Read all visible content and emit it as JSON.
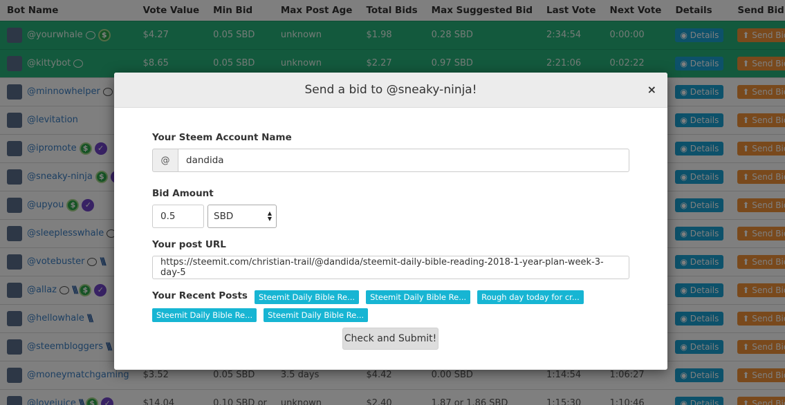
{
  "table": {
    "headers": [
      "Bot Name",
      "Vote Value",
      "Min Bid",
      "Max Post Age",
      "Total Bids",
      "Max Suggested Bid",
      "Last Vote",
      "Next Vote",
      "Details",
      "Send Bid"
    ],
    "details_label": "Details",
    "send_label": "Send Bid",
    "rows": [
      {
        "name": "@yourwhale",
        "vote_value": "$4.27",
        "min_bid": "0.05 SBD",
        "max_age": "unknown",
        "total_bids": "$1.98",
        "max_bid": "0.28 SBD",
        "last_vote": "2:34:54",
        "next_vote": "0:00:00",
        "active": true,
        "icons": [
          "comment-icon",
          "dollar-icon"
        ]
      },
      {
        "name": "@kittybot",
        "vote_value": "$8.65",
        "min_bid": "0.05 SBD",
        "max_age": "unknown",
        "total_bids": "$2.27",
        "max_bid": "0.97 SBD",
        "last_vote": "2:21:06",
        "next_vote": "0:02:22",
        "active": true,
        "icons": [
          "comment-icon"
        ]
      },
      {
        "name": "@minnowhelper",
        "vote_value": "",
        "min_bid": "",
        "max_age": "",
        "total_bids": "",
        "max_bid": "",
        "last_vote": "",
        "next_vote": "",
        "active": false,
        "icons": [
          "comment-icon"
        ]
      },
      {
        "name": "@levitation",
        "vote_value": "",
        "min_bid": "",
        "max_age": "",
        "total_bids": "",
        "max_bid": "",
        "last_vote": "",
        "next_vote": "",
        "active": false,
        "icons": []
      },
      {
        "name": "@ipromote",
        "vote_value": "",
        "min_bid": "",
        "max_age": "",
        "total_bids": "",
        "max_bid": "",
        "last_vote": "",
        "next_vote": "",
        "active": false,
        "icons": [
          "dollar-icon",
          "check-icon"
        ]
      },
      {
        "name": "@sneaky-ninja",
        "vote_value": "",
        "min_bid": "",
        "max_age": "",
        "total_bids": "",
        "max_bid": "",
        "last_vote": "",
        "next_vote": "",
        "active": false,
        "icons": [
          "dollar-icon",
          "check-icon"
        ]
      },
      {
        "name": "@upyou",
        "vote_value": "",
        "min_bid": "",
        "max_age": "",
        "total_bids": "",
        "max_bid": "",
        "last_vote": "",
        "next_vote": "",
        "active": false,
        "icons": [
          "dollar-icon",
          "check-icon"
        ]
      },
      {
        "name": "@sleeplesswhale",
        "vote_value": "",
        "min_bid": "",
        "max_age": "",
        "total_bids": "",
        "max_bid": "",
        "last_vote": "",
        "next_vote": "",
        "active": false,
        "icons": [
          "comment-icon"
        ]
      },
      {
        "name": "@votebuster",
        "vote_value": "",
        "min_bid": "",
        "max_age": "",
        "total_bids": "",
        "max_bid": "",
        "last_vote": "",
        "next_vote": "",
        "active": false,
        "icons": [
          "comment-icon",
          "steem-icon"
        ]
      },
      {
        "name": "@allaz",
        "vote_value": "",
        "min_bid": "",
        "max_age": "",
        "total_bids": "",
        "max_bid": "",
        "last_vote": "",
        "next_vote": "",
        "active": false,
        "icons": [
          "comment-icon",
          "steem-icon",
          "dollar-icon",
          "check-icon"
        ]
      },
      {
        "name": "@hellowhale",
        "vote_value": "",
        "min_bid": "",
        "max_age": "",
        "total_bids": "",
        "max_bid": "",
        "last_vote": "",
        "next_vote": "",
        "active": false,
        "icons": [
          "steem-icon"
        ]
      },
      {
        "name": "@steembloggers",
        "vote_value": "",
        "min_bid": "",
        "max_age": "",
        "total_bids": "",
        "max_bid": "",
        "last_vote": "",
        "next_vote": "",
        "active": false,
        "icons": [
          "steem-icon"
        ]
      },
      {
        "name": "@moneymatchgaming",
        "vote_value": "$3.52",
        "min_bid": "0.05 SBD",
        "max_age": "3.5 days",
        "total_bids": "$4.42",
        "max_bid": "0.00 SBD",
        "last_vote": "1:14:54",
        "next_vote": "1:06:27",
        "active": false,
        "icons": []
      },
      {
        "name": "@lovejuice",
        "vote_value": "$14.04",
        "min_bid": "0.10 SBD or",
        "max_age": "unknown",
        "total_bids": "$2.40",
        "max_bid": "1.87 or 1.86 SBD",
        "last_vote": "1:15:30",
        "next_vote": "1:10:46",
        "active": false,
        "icons": [
          "steem-icon",
          "dollar-icon",
          "check-icon"
        ]
      }
    ]
  },
  "modal": {
    "title": "Send a bid to @sneaky-ninja!",
    "close": "×",
    "account_label": "Your Steem Account Name",
    "account_prefix": "@",
    "account_value": "dandida",
    "amount_label": "Bid Amount",
    "amount_value": "0.5",
    "currency_selected": "SBD",
    "url_label": "Your post URL",
    "url_value": "https://steemit.com/christian-trail/@dandida/steemit-daily-bible-reading-2018-1-year-plan-week-3-day-5",
    "recent_label": "Your Recent Posts",
    "recent_posts": [
      "Steemit Daily Bible Re...",
      "Steemit Daily Bible Re...",
      "Rough day today for cr...",
      "Steemit Daily Bible Re...",
      "Steemit Daily Bible Re..."
    ],
    "submit_label": "Check and Submit!"
  },
  "colors": {
    "active_row": "#26b27a",
    "details_button": "#1aa3d5",
    "send_button": "#f39338",
    "post_tag": "#17b5d3",
    "link": "#3b7fc4"
  }
}
